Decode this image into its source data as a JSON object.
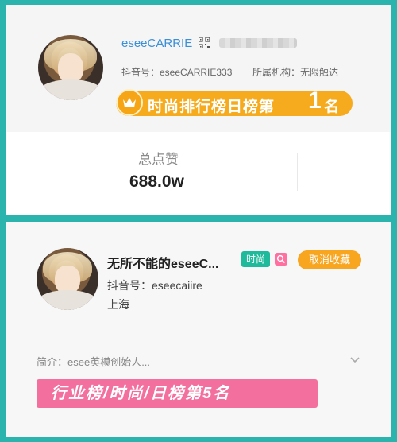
{
  "panel1": {
    "username": "eseeCARRIE",
    "douyin_id": "抖音号：eseeCARRIE333",
    "agency": "所属机构：无限触达",
    "rank_banner": {
      "text": "时尚排行榜日榜第",
      "number": "1",
      "suffix": "名"
    },
    "likes_label": "总点赞",
    "likes_value": "688.0w"
  },
  "panel2": {
    "username": "无所不能的eseeC...",
    "tag": "时尚",
    "unfavorite_button": "取消收藏",
    "douyin_id": "抖音号：eseecaiire",
    "location": "上海",
    "intro": "简介：esee英模创始人...",
    "industry_rank": "行业榜/时尚/日榜第5名"
  },
  "colors": {
    "background": "#2bb3ad",
    "rank_orange": "#f6ab1e",
    "link_blue": "#3a8fd8",
    "tag_green": "#1fb99b",
    "tag_pink": "#ff6fa0",
    "industry_pink": "#f36f9e"
  },
  "icons": [
    "qr-code-icon",
    "crown-icon",
    "search-icon",
    "chevron-down-icon"
  ]
}
